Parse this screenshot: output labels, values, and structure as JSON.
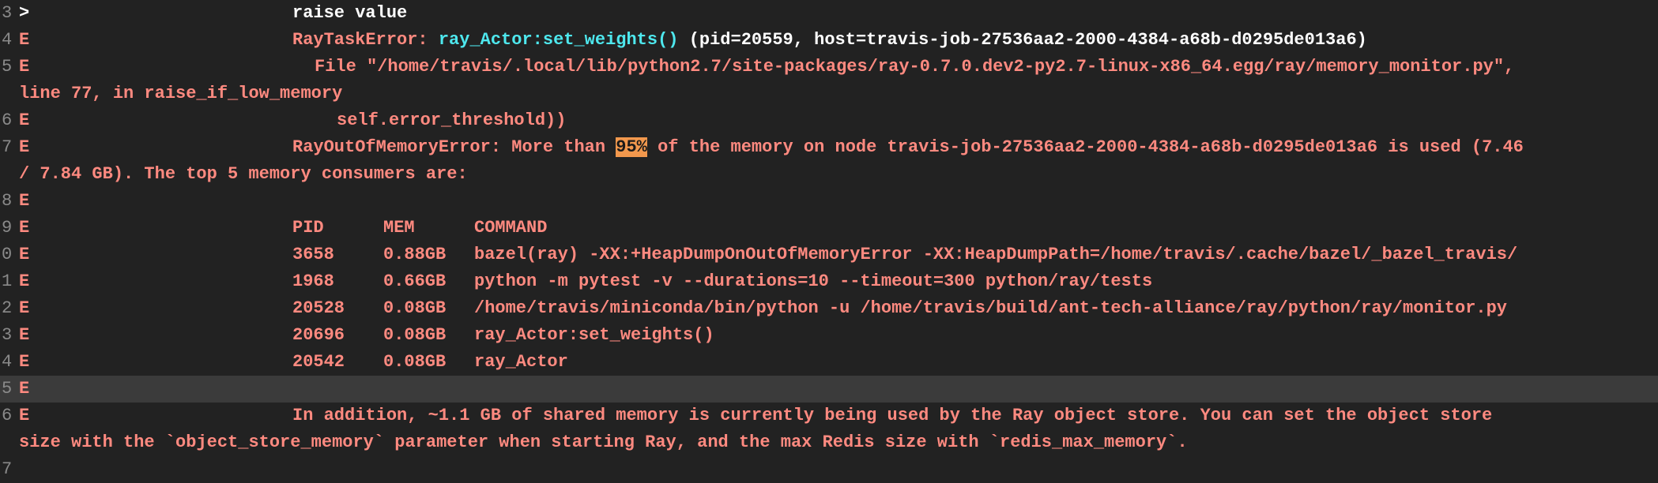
{
  "colors": {
    "background": "#222222",
    "error_text": "#ff8a80",
    "function_name": "#4ee8ee",
    "line_number": "#8a8a8a",
    "highlight": "#f2984d",
    "current_row": "#3b3b3b"
  },
  "lines": {
    "l0": {
      "num": "3",
      "marker": ">",
      "text": "raise value"
    },
    "l1": {
      "num": "4",
      "marker": "E",
      "error_type": "RayTaskError:",
      "func": "ray_Actor:set_weights()",
      "details": "(pid=20559, host=travis-job-27536aa2-2000-4384-a68b-d0295de013a6)"
    },
    "l2": {
      "num": "5",
      "marker": "E",
      "text_a": "File \"/home/travis/.local/lib/python2.7/site-packages/ray-0.7.0.dev2-py2.7-linux-x86_64.egg/ray/memory_monitor.py\",",
      "text_b": "line 77, in raise_if_low_memory"
    },
    "l3": {
      "num": "6",
      "marker": "E",
      "text": "self.error_threshold))"
    },
    "l4": {
      "num": "7",
      "marker": "E",
      "text_before": "RayOutOfMemoryError: More than ",
      "highlight": "95%",
      "text_after": " of the memory on node travis-job-27536aa2-2000-4384-a68b-d0295de013a6 is used (7.46",
      "text_wrap": "/ 7.84 GB). The top 5 memory consumers are:"
    },
    "l5": {
      "num": "8",
      "marker": "E"
    },
    "l6": {
      "num": "9",
      "marker": "E",
      "col_pid": "PID",
      "col_mem": "MEM",
      "col_cmd": "COMMAND"
    },
    "l7": {
      "num": "0",
      "marker": "E",
      "pid": "3658",
      "mem": "0.88GB",
      "cmd": "bazel(ray) -XX:+HeapDumpOnOutOfMemoryError -XX:HeapDumpPath=/home/travis/.cache/bazel/_bazel_travis/"
    },
    "l8": {
      "num": "1",
      "marker": "E",
      "pid": "1968",
      "mem": "0.66GB",
      "cmd": "python -m pytest -v --durations=10 --timeout=300 python/ray/tests"
    },
    "l9": {
      "num": "2",
      "marker": "E",
      "pid": "20528",
      "mem": "0.08GB",
      "cmd": "/home/travis/miniconda/bin/python -u /home/travis/build/ant-tech-alliance/ray/python/ray/monitor.py"
    },
    "l10": {
      "num": "3",
      "marker": "E",
      "pid": "20696",
      "mem": "0.08GB",
      "cmd": "ray_Actor:set_weights()"
    },
    "l11": {
      "num": "4",
      "marker": "E",
      "pid": "20542",
      "mem": "0.08GB",
      "cmd": "ray_Actor"
    },
    "l12": {
      "num": "5",
      "marker": "E"
    },
    "l13": {
      "num": "6",
      "marker": "E",
      "text_a": "In addition, ~1.1 GB of shared memory is currently being used by the Ray object store. You can set the object store",
      "text_b": "size with the `object_store_memory` parameter when starting Ray, and the max Redis size with `redis_max_memory`."
    },
    "l14": {
      "num": "7"
    }
  }
}
